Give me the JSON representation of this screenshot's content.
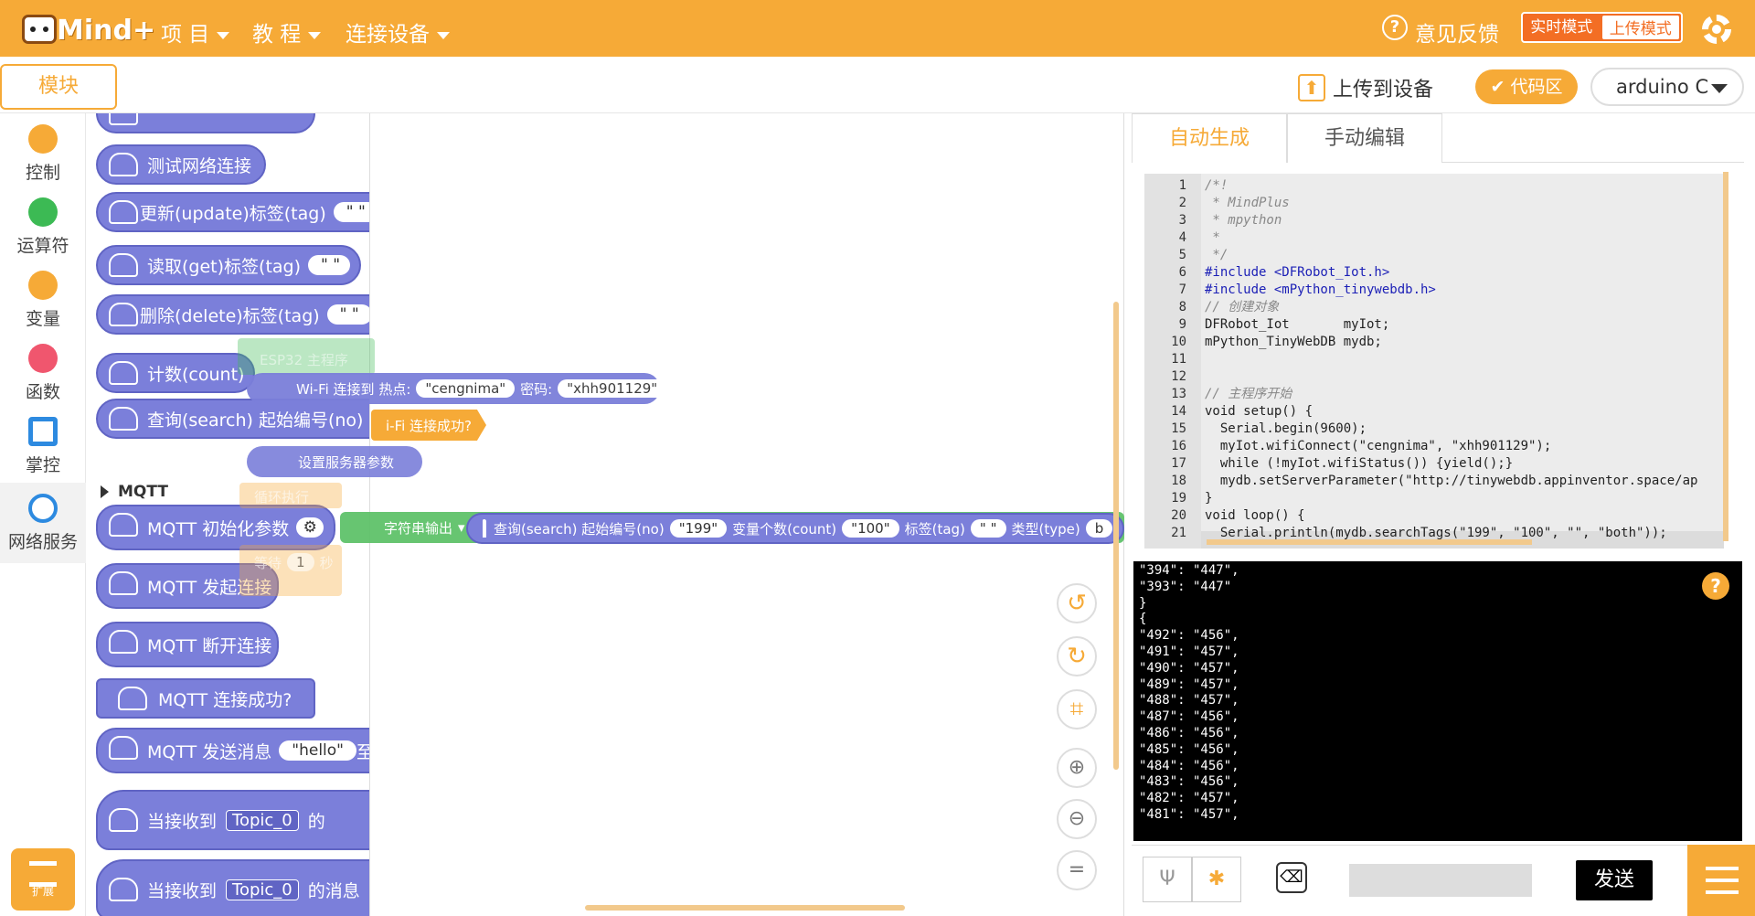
{
  "app": {
    "logo_text": "Mind+"
  },
  "menu": {
    "project": "项 目",
    "tutorial": "教 程",
    "connect": "连接设备"
  },
  "header_right": {
    "feedback": "意见反馈",
    "mode_realtime": "实时模式",
    "mode_upload": "上传模式"
  },
  "toolbar": {
    "module_tab": "模块",
    "upload_label": "上传到设备",
    "code_area": "代码区",
    "board": "arduino C"
  },
  "categories": [
    {
      "label": "控制",
      "color": "#f6aa37"
    },
    {
      "label": "运算符",
      "color": "#3cba54"
    },
    {
      "label": "变量",
      "color": "#f6aa37"
    },
    {
      "label": "函数",
      "color": "#f0566e"
    },
    {
      "label": "掌控",
      "color": "#2d8ae0"
    },
    {
      "label": "网络服务",
      "color": "#2d8ae0"
    }
  ],
  "extension": {
    "label": "扩展"
  },
  "palette": {
    "test_conn": "测试网络连接",
    "update_tag": "更新(update)标签(tag)",
    "get_tag": "读取(get)标签(tag)",
    "delete_tag": "删除(delete)标签(tag)",
    "count": "计数(count)",
    "search": "查询(search) 起始编号(no)",
    "empty_str": "\" \"",
    "mqtt_header": "MQTT",
    "mqtt_init": "MQTT 初始化参数",
    "mqtt_connect": "MQTT 发起连接",
    "mqtt_disconnect": "MQTT 断开连接",
    "mqtt_connected": "MQTT 连接成功?",
    "mqtt_send": "MQTT 发送消息",
    "mqtt_send_value": "\"hello\"",
    "mqtt_send_to": "至",
    "on_receive1": "当接收到",
    "on_receive1_topic": "Topic_0",
    "on_receive1_tail": "的",
    "on_receive2": "当接收到",
    "on_receive2_topic": "Topic_0",
    "on_receive2_tail": "的消息",
    "mqtt_icon_text": "MQTT"
  },
  "canvas": {
    "esp32": "ESP32 主程序",
    "wifi_connect": "Wi-Fi 连接到 热点:",
    "ssid": "\"cengnima\"",
    "pwd_label": "密码:",
    "pwd": "\"xhh901129\"",
    "wifi_ok": "i-Fi 连接成功?",
    "set_server": "设置服务器参数",
    "loop": "循环执行",
    "wait": "等待",
    "wait_val": "1",
    "wait_unit": "秒",
    "serial_out": "字符串输出",
    "search_call": "查询(search) 起始编号(no)",
    "no_val": "\"199\"",
    "count_label": "变量个数(count)",
    "count_val": "\"100\"",
    "tag_label": "标签(tag)",
    "tag_val": "\" \"",
    "type_label": "类型(type)",
    "type_tail": "b"
  },
  "code_tabs": {
    "auto": "自动生成",
    "manual": "手动编辑"
  },
  "code_lines": [
    {
      "n": "1",
      "t": "/*!",
      "c": "#888"
    },
    {
      "n": "2",
      "t": " * MindPlus",
      "c": "#888"
    },
    {
      "n": "3",
      "t": " * mpython",
      "c": "#888"
    },
    {
      "n": "4",
      "t": " *",
      "c": "#888"
    },
    {
      "n": "5",
      "t": " */",
      "c": "#888"
    },
    {
      "n": "6",
      "t": "#include <DFRobot_Iot.h>",
      "c": "#1b1fb6"
    },
    {
      "n": "7",
      "t": "#include <mPython_tinywebdb.h>",
      "c": "#1b1fb6"
    },
    {
      "n": "8",
      "t": "// 创建对象",
      "c": "#888"
    },
    {
      "n": "9",
      "t": "DFRobot_Iot       myIot;",
      "c": "#222"
    },
    {
      "n": "10",
      "t": "mPython_TinyWebDB mydb;",
      "c": "#222"
    },
    {
      "n": "11",
      "t": "",
      "c": "#222"
    },
    {
      "n": "12",
      "t": "",
      "c": "#222"
    },
    {
      "n": "13",
      "t": "// 主程序开始",
      "c": "#888"
    },
    {
      "n": "14",
      "t": "void setup() {",
      "c": "#222"
    },
    {
      "n": "15",
      "t": "  Serial.begin(9600);",
      "c": "#222"
    },
    {
      "n": "16",
      "t": "  myIot.wifiConnect(\"cengnima\", \"xhh901129\");",
      "c": "#222"
    },
    {
      "n": "17",
      "t": "  while (!myIot.wifiStatus()) {yield();}",
      "c": "#222"
    },
    {
      "n": "18",
      "t": "  mydb.setServerParameter(\"http://tinywebdb.appinventor.space/ap",
      "c": "#222"
    },
    {
      "n": "19",
      "t": "}",
      "c": "#222"
    },
    {
      "n": "20",
      "t": "void loop() {",
      "c": "#222"
    },
    {
      "n": "21",
      "t": "  Serial.println(mydb.searchTags(\"199\", \"100\", \"\", \"both\"));",
      "c": "#222"
    }
  ],
  "console_lines": [
    "\"394\": \"447\",",
    "\"393\": \"447\"",
    "}",
    "{",
    "\"492\": \"456\",",
    "\"491\": \"457\",",
    "\"490\": \"457\",",
    "\"489\": \"457\",",
    "\"488\": \"457\",",
    "\"487\": \"456\",",
    "\"486\": \"456\",",
    "\"485\": \"456\",",
    "\"484\": \"456\",",
    "\"483\": \"456\",",
    "\"482\": \"457\",",
    "\"481\": \"457\","
  ],
  "serial": {
    "send_label": "发送",
    "input_value": ""
  }
}
